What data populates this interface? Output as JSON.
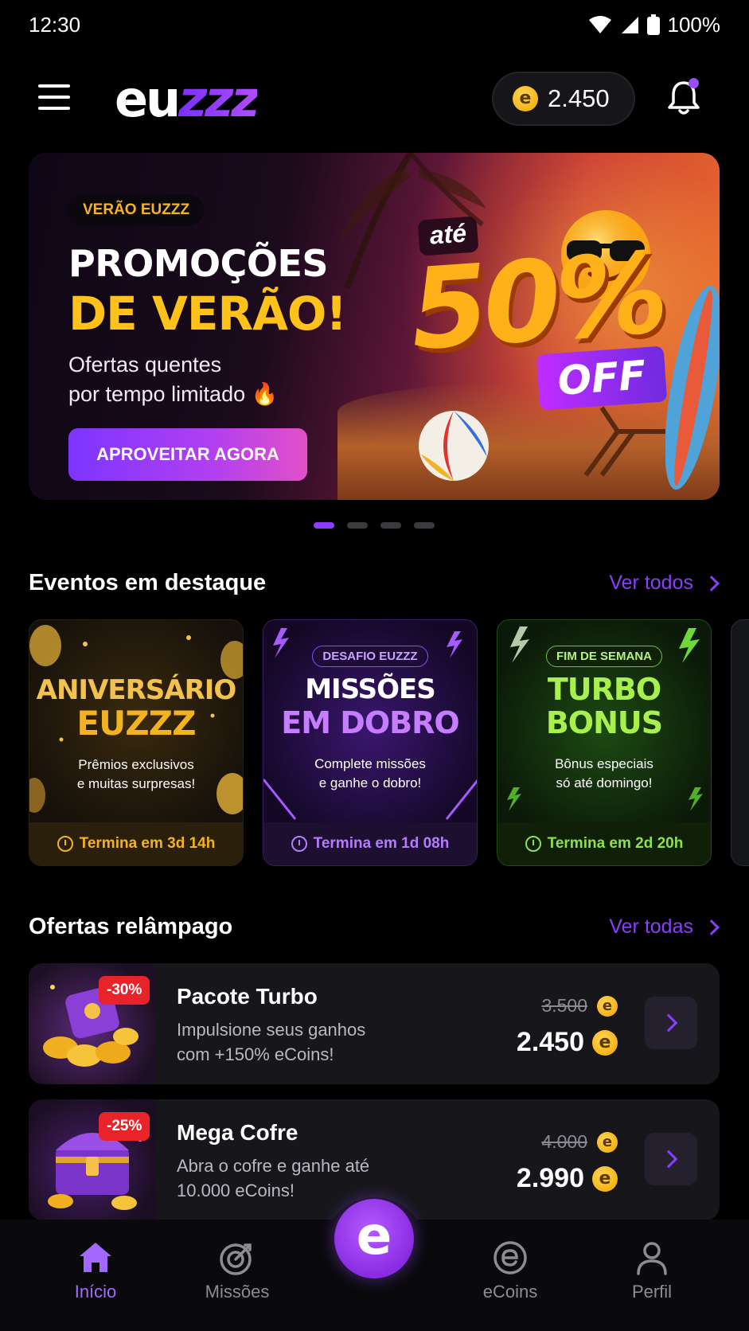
{
  "status_bar": {
    "time": "12:30",
    "battery": "100%"
  },
  "header": {
    "logo_part1": "eu",
    "logo_part2": "zzz",
    "coin_symbol": "e",
    "coin_balance": "2.450",
    "has_notification": true
  },
  "banner": {
    "tag": "VERÃO EUZZZ",
    "title_line1": "PROMOÇÕES",
    "title_line2": "DE VERÃO!",
    "subtitle_line1": "Ofertas quentes",
    "subtitle_line2": "por tempo limitado 🔥",
    "cta_label": "APROVEITAR AGORA",
    "discount_prefix": "até",
    "discount_value": "50%",
    "discount_suffix": "OFF",
    "pagination": {
      "total": 4,
      "active_index": 0
    }
  },
  "events_section": {
    "title": "Eventos em destaque",
    "link_label": "Ver todos",
    "cards": [
      {
        "badge": "",
        "title_line1": "ANIVERSÁRIO",
        "title_line2": "EUZZZ",
        "desc_line1": "Prêmios exclusivos",
        "desc_line2": "e muitas surpresas!",
        "timer": "Termina em 3d 14h",
        "accent": "#f3b321"
      },
      {
        "badge": "DESAFIO EUZZZ",
        "title_line1": "MISSÕES",
        "title_line2": "EM DOBRO",
        "desc_line1": "Complete missões",
        "desc_line2": "e ganhe o dobro!",
        "timer": "Termina em 1d 08h",
        "accent": "#b57bff"
      },
      {
        "badge": "FIM DE SEMANA",
        "title_line1": "TURBO",
        "title_line2": "BONUS",
        "desc_line1": "Bônus especiais",
        "desc_line2": "só até domingo!",
        "timer": "Termina em 2d 20h",
        "accent": "#8ee04c"
      }
    ]
  },
  "offers_section": {
    "title": "Ofertas relâmpago",
    "link_label": "Ver todas",
    "items": [
      {
        "discount": "-30%",
        "title": "Pacote Turbo",
        "desc_line1": "Impulsione seus ganhos",
        "desc_line2": "com +150% eCoins!",
        "old_price": "3.500",
        "new_price": "2.450"
      },
      {
        "discount": "-25%",
        "title": "Mega Cofre",
        "desc_line1": "Abra o cofre e ganhe até",
        "desc_line2": "10.000 eCoins!",
        "old_price": "4.000",
        "new_price": "2.990"
      }
    ]
  },
  "bottom_nav": {
    "items": [
      {
        "label": "Início",
        "icon": "home-icon",
        "active": true
      },
      {
        "label": "Missões",
        "icon": "target-icon",
        "active": false
      },
      {
        "label": "",
        "icon": "euzzz-e-icon",
        "active": false
      },
      {
        "label": "eCoins",
        "icon": "ecoin-icon",
        "active": false
      },
      {
        "label": "Perfil",
        "icon": "user-icon",
        "active": false
      }
    ],
    "fab_letter": "e"
  },
  "colors": {
    "accent_purple": "#8b3dff",
    "gold": "#ffc21a",
    "sale_red": "#e8242a",
    "background": "#000000"
  }
}
